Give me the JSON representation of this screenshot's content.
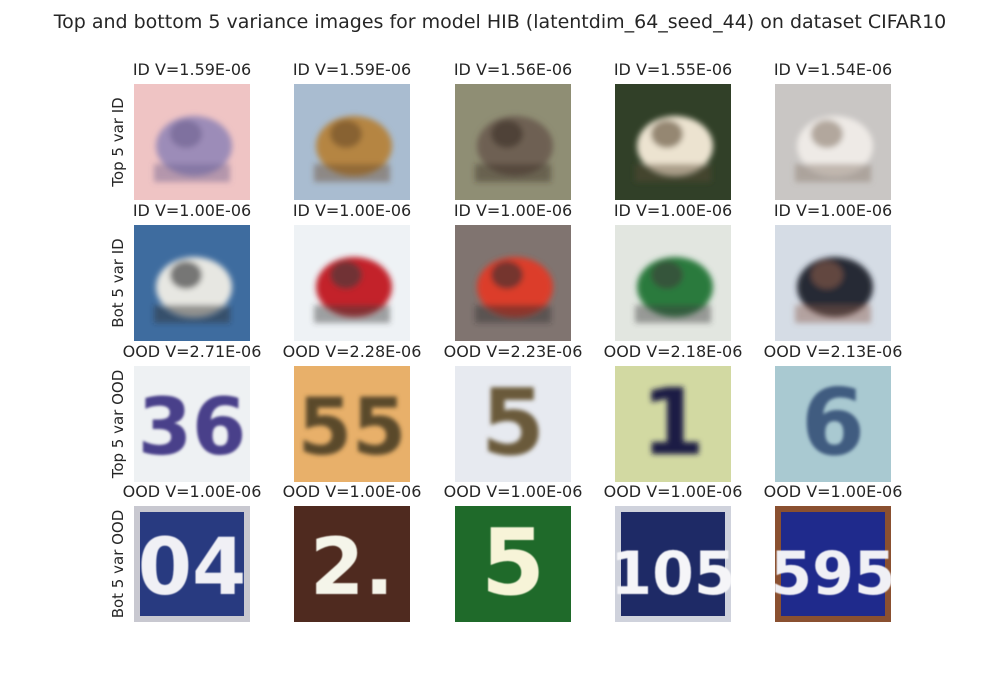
{
  "title": "Top and bottom 5 variance images for model HIB (latentdim_64_seed_44) on dataset CIFAR10",
  "rows": [
    {
      "label": "Top 5 var ID",
      "images": [
        {
          "caption": "ID V=1.59E-06",
          "kind": "photo",
          "bg": "#efc4c4",
          "fg": "#9c8cb8",
          "accent": "#6d5f8e"
        },
        {
          "caption": "ID V=1.59E-06",
          "kind": "photo",
          "bg": "#a9bcd0",
          "fg": "#b58543",
          "accent": "#6b4b2a"
        },
        {
          "caption": "ID V=1.56E-06",
          "kind": "photo",
          "bg": "#8f8e74",
          "fg": "#6e6153",
          "accent": "#3a2e24"
        },
        {
          "caption": "ID V=1.55E-06",
          "kind": "photo",
          "bg": "#314028",
          "fg": "#ece3d0",
          "accent": "#5b4933"
        },
        {
          "caption": "ID V=1.54E-06",
          "kind": "photo",
          "bg": "#c9c6c4",
          "fg": "#eeeae6",
          "accent": "#8a7a6c"
        }
      ]
    },
    {
      "label": "Bot 5 var ID",
      "images": [
        {
          "caption": "ID V=1.00E-06",
          "kind": "photo",
          "bg": "#3e6c9f",
          "fg": "#e7e7e2",
          "accent": "#2b2b2b"
        },
        {
          "caption": "ID V=1.00E-06",
          "kind": "photo",
          "bg": "#eef2f5",
          "fg": "#c3232b",
          "accent": "#3a3a3a"
        },
        {
          "caption": "ID V=1.00E-06",
          "kind": "photo",
          "bg": "#807470",
          "fg": "#dc3c2b",
          "accent": "#2f2f2f"
        },
        {
          "caption": "ID V=1.00E-06",
          "kind": "photo",
          "bg": "#e2e6e0",
          "fg": "#2c7a3e",
          "accent": "#3a3a3a"
        },
        {
          "caption": "ID V=1.00E-06",
          "kind": "photo",
          "bg": "#d5dce5",
          "fg": "#262a36",
          "accent": "#8a5a4a"
        }
      ]
    },
    {
      "label": "Top 5 var OOD",
      "images": [
        {
          "caption": "OOD V=2.71E-06",
          "kind": "digit",
          "text": "36",
          "bg": "#eef1f3",
          "fg": "#4a3f8a",
          "blur": 1.2
        },
        {
          "caption": "OOD V=2.28E-06",
          "kind": "digit",
          "text": "55",
          "bg": "#e8b06a",
          "fg": "#5a4a2a",
          "blur": 2.2
        },
        {
          "caption": "OOD V=2.23E-06",
          "kind": "digit",
          "text": "5",
          "bg": "#e7eaf0",
          "fg": "#6a5a3a",
          "blur": 2.2
        },
        {
          "caption": "OOD V=2.18E-06",
          "kind": "digit",
          "text": "1",
          "bg": "#d2d9a2",
          "fg": "#1e1a44",
          "blur": 2.6
        },
        {
          "caption": "OOD V=2.13E-06",
          "kind": "digit",
          "text": "6",
          "bg": "#a9c9d1",
          "fg": "#3f5b80",
          "blur": 1.6
        }
      ]
    },
    {
      "label": "Bot 5 var OOD",
      "images": [
        {
          "caption": "OOD V=1.00E-06",
          "kind": "digit",
          "text": "04",
          "bg": "#283a80",
          "fg": "#f0f0f5",
          "border": "#c8c8d0",
          "blur": 0.4
        },
        {
          "caption": "OOD V=1.00E-06",
          "kind": "digit",
          "text": "2.",
          "bg": "#4f2a1f",
          "fg": "#f5f5ea",
          "border": "#4f2a1f",
          "blur": 0.4
        },
        {
          "caption": "OOD V=1.00E-06",
          "kind": "digit",
          "text": "5",
          "bg": "#1f6a2a",
          "fg": "#f7f4d8",
          "border": "#1f6a2a",
          "blur": 0.4
        },
        {
          "caption": "OOD V=1.00E-06",
          "kind": "digit",
          "text": "105",
          "bg": "#1e2a66",
          "fg": "#f5f5f8",
          "border": "#cfd2dc",
          "blur": 0.4
        },
        {
          "caption": "OOD V=1.00E-06",
          "kind": "digit",
          "text": "595",
          "bg": "#1f2a8c",
          "fg": "#f0f0f5",
          "border": "#8a5030",
          "blur": 0.4
        }
      ]
    }
  ]
}
